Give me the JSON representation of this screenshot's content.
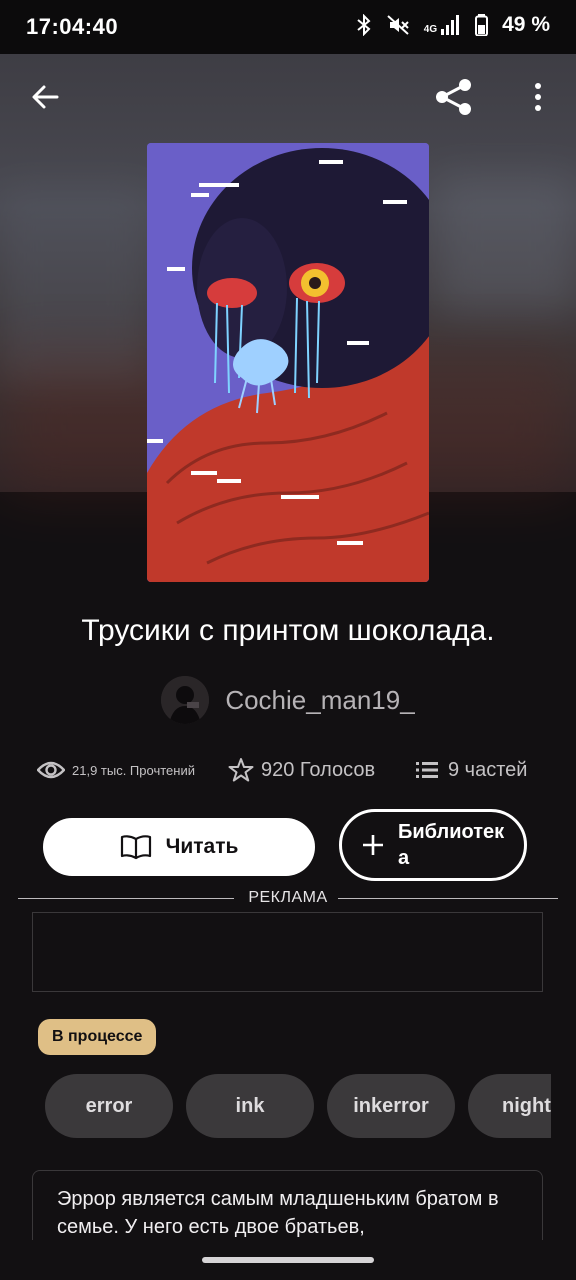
{
  "status": {
    "time": "17:04:40",
    "battery": "49 %",
    "network": "4G",
    "icons": [
      "bluetooth-icon",
      "mute-icon",
      "signal-icon",
      "battery-icon"
    ]
  },
  "toolbar": {
    "back_icon": "arrow-left-icon",
    "share_icon": "share-icon",
    "more_icon": "more-vert-icon"
  },
  "story": {
    "title": "Трусики с принтом шоколада.",
    "author": "Cochie_man19_",
    "reads": "21,9 тыс. Прочтений",
    "votes": "920 Голосов",
    "parts": "9 частей",
    "status_badge": "В процессе",
    "description": "Эррор является самым младшеньким братом в семье. У него есть двое братьев,"
  },
  "actions": {
    "read_label": "Читать",
    "library_label": "Библиотек\nа"
  },
  "ad": {
    "label": "РЕКЛАМА"
  },
  "tags": [
    "error",
    "ink",
    "inkerror",
    "nighte"
  ],
  "colors": {
    "background": "#121012",
    "badge": "#dfbf86",
    "tag_bg": "#3b393b",
    "cover_bg": "#6a5fc8",
    "scarf": "#c0392b"
  }
}
